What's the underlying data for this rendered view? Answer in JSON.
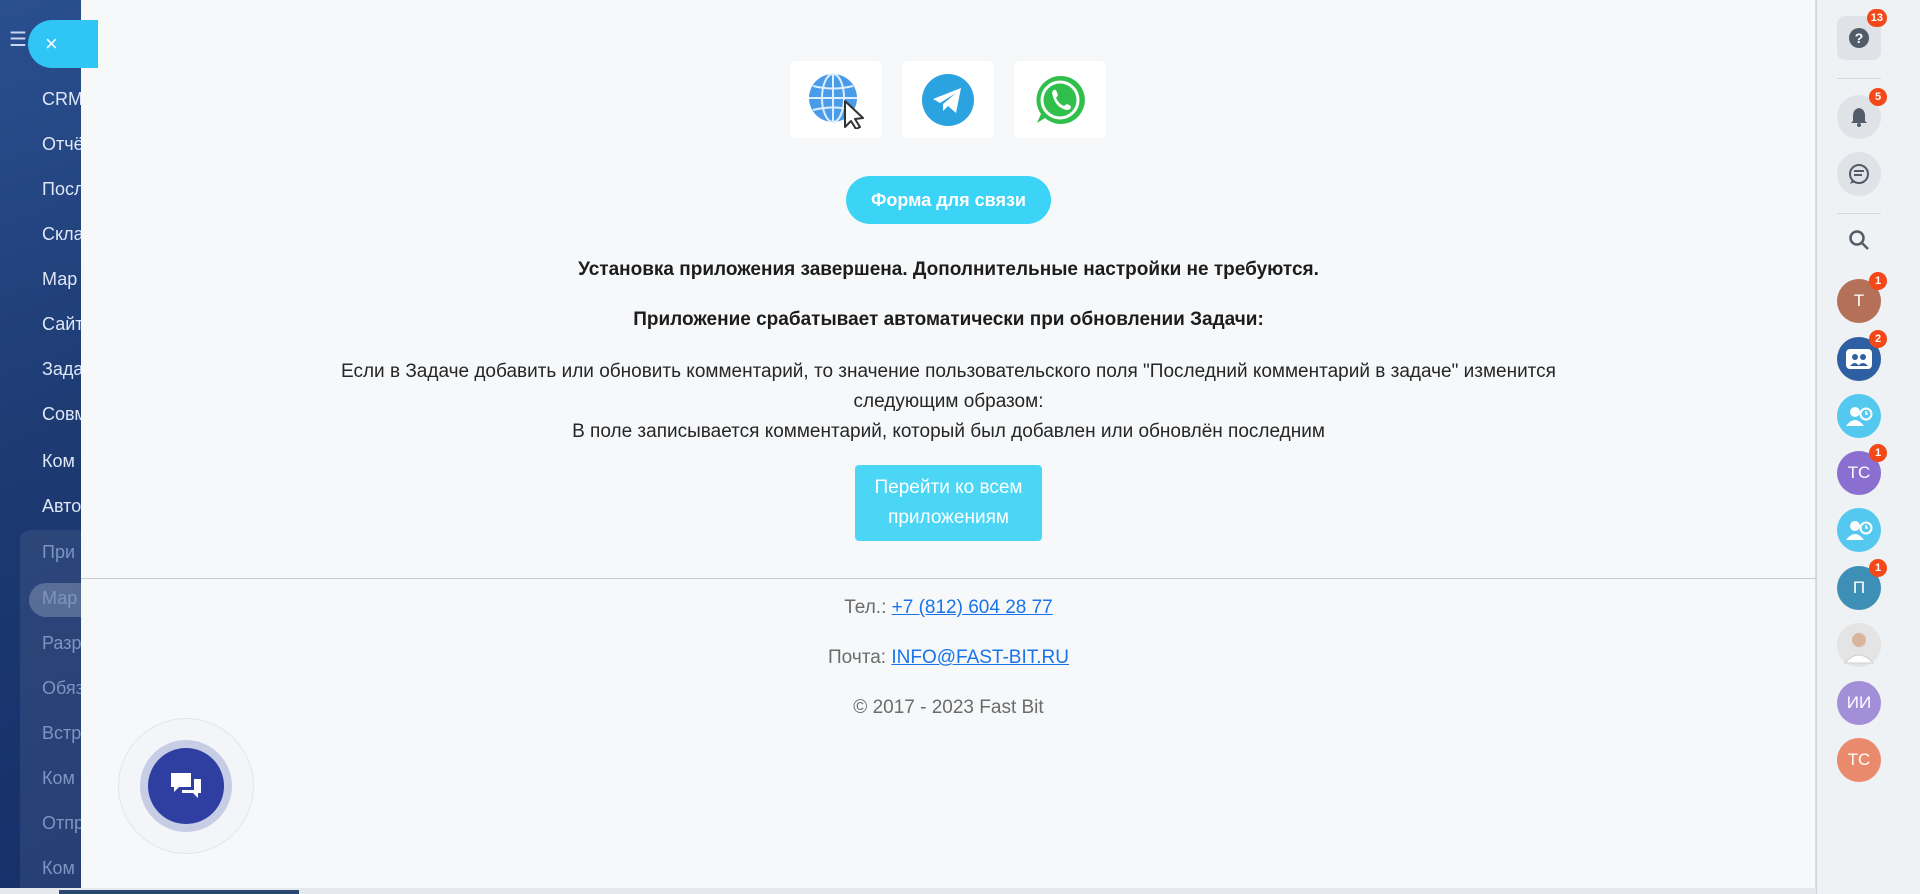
{
  "left_sidebar": {
    "items": [
      "CRM",
      "Отчё",
      "Посл",
      "Скла",
      "Мар",
      "Сайт",
      "Зада",
      "Совм",
      "Ком",
      "Авто",
      "При",
      "Мар",
      "Разр",
      "Обяз",
      "Встр",
      "Ком",
      "Отпр",
      "Ком"
    ]
  },
  "slider": {
    "close_icon": "×",
    "form_button": "Форма для связи",
    "install_done": "Установка приложения завершена. Дополнительные настройки не требуются.",
    "trigger_text": "Приложение срабатывает автоматически при обновлении Задачи:",
    "description_line1": "Если в Задаче добавить или обновить комментарий, то значение пользовательского поля \"Последний комментарий в задаче\" изменится следующим образом:",
    "description_line2": "В поле записывается комментарий, который был добавлен или обновлён последним",
    "apps_button": "Перейти ко всем приложениям",
    "phone_label": "Тел.:",
    "phone_value": "+7 (812) 604 28 77",
    "mail_label": "Почта:",
    "mail_value": "INFO@FAST-BIT.RU",
    "copyright": "© 2017 - 2023 Fast Bit"
  },
  "right_sidebar": {
    "help_badge": "13",
    "notifications_badge": "5",
    "avatars": [
      {
        "initials": "Т",
        "color": "#b5705a",
        "badge": "1"
      },
      {
        "initials": "",
        "color": "#2f5fa3",
        "badge": "2",
        "icon": "group-chat-icon"
      },
      {
        "initials": "",
        "color": "#55c8f0",
        "badge": "",
        "icon": "user-clock-icon"
      },
      {
        "initials": "ТС",
        "color": "#8a6fd1",
        "badge": "1"
      },
      {
        "initials": "",
        "color": "#55c8f0",
        "badge": "",
        "icon": "user-clock-icon"
      },
      {
        "initials": "П",
        "color": "#3d8fb5",
        "badge": "1"
      },
      {
        "initials": "",
        "color": "#d9d9d9",
        "badge": "",
        "icon": "photo-avatar"
      },
      {
        "initials": "ИИ",
        "color": "#a38fd8",
        "badge": ""
      },
      {
        "initials": "ТС",
        "color": "#e98a6c",
        "badge": ""
      }
    ]
  },
  "colors": {
    "accent": "#2fc6f6",
    "badge": "#f54819",
    "link": "#1a73e8"
  }
}
